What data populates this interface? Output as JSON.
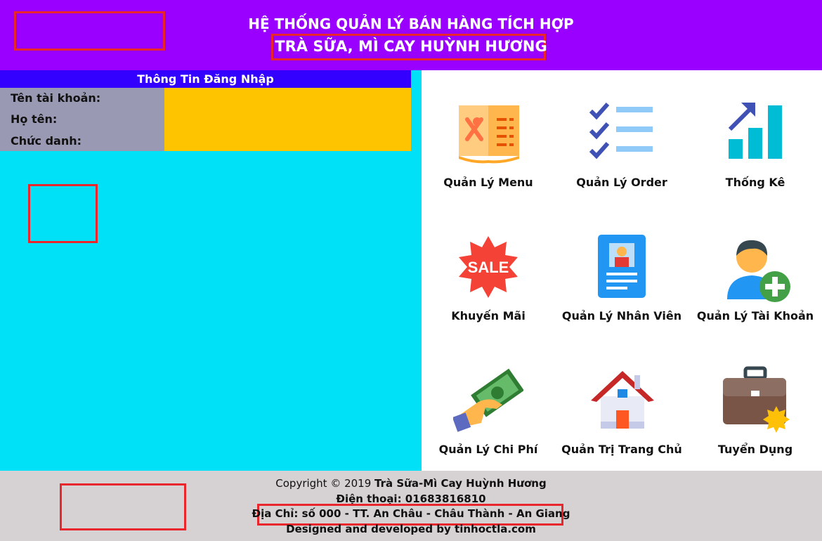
{
  "header": {
    "title_line1": "HỆ THỐNG QUẢN LÝ BÁN HÀNG TÍCH HỢP",
    "title_line2": "TRÀ SỮA, MÌ CAY HUỲNH HƯƠNG"
  },
  "login": {
    "heading": "Thông Tin Đăng Nhập",
    "username_label": "Tên tài khoản:",
    "fullname_label": "Họ tên:",
    "role_label": "Chức danh:"
  },
  "tiles": [
    {
      "label": "Quản Lý Menu",
      "icon": "menu-book-icon"
    },
    {
      "label": "Quản Lý Order",
      "icon": "checklist-icon"
    },
    {
      "label": "Thống Kê",
      "icon": "bar-chart-icon"
    },
    {
      "label": "Khuyến Mãi",
      "icon": "sale-badge-icon"
    },
    {
      "label": "Quản Lý Nhân Viên",
      "icon": "employee-card-icon"
    },
    {
      "label": "Quản Lý Tài Khoản",
      "icon": "add-user-icon"
    },
    {
      "label": "Quản Lý Chi Phí",
      "icon": "money-hand-icon"
    },
    {
      "label": "Quản Trị Trang Chủ",
      "icon": "house-icon"
    },
    {
      "label": "Tuyển Dụng",
      "icon": "briefcase-icon"
    }
  ],
  "footer": {
    "copyright_prefix": "Copyright © 2019 ",
    "copyright_brand": "Trà Sữa-Mì Cay Huỳnh Hương",
    "phone": "Điện thoại: 01683816810",
    "address": "Địa Chỉ: số 000 - TT. An Châu - Châu Thành - An Giang",
    "designed": "Designed and developed by tinhoctla.com"
  },
  "colors": {
    "header_bg": "#9900ff",
    "login_heading_bg": "#3300ff",
    "left_panel_bg": "#00e1f8",
    "values_bg": "#ffc400",
    "labels_bg": "#9999b3",
    "footer_bg": "#d6d1d2",
    "highlight_border": "#e8262b"
  }
}
